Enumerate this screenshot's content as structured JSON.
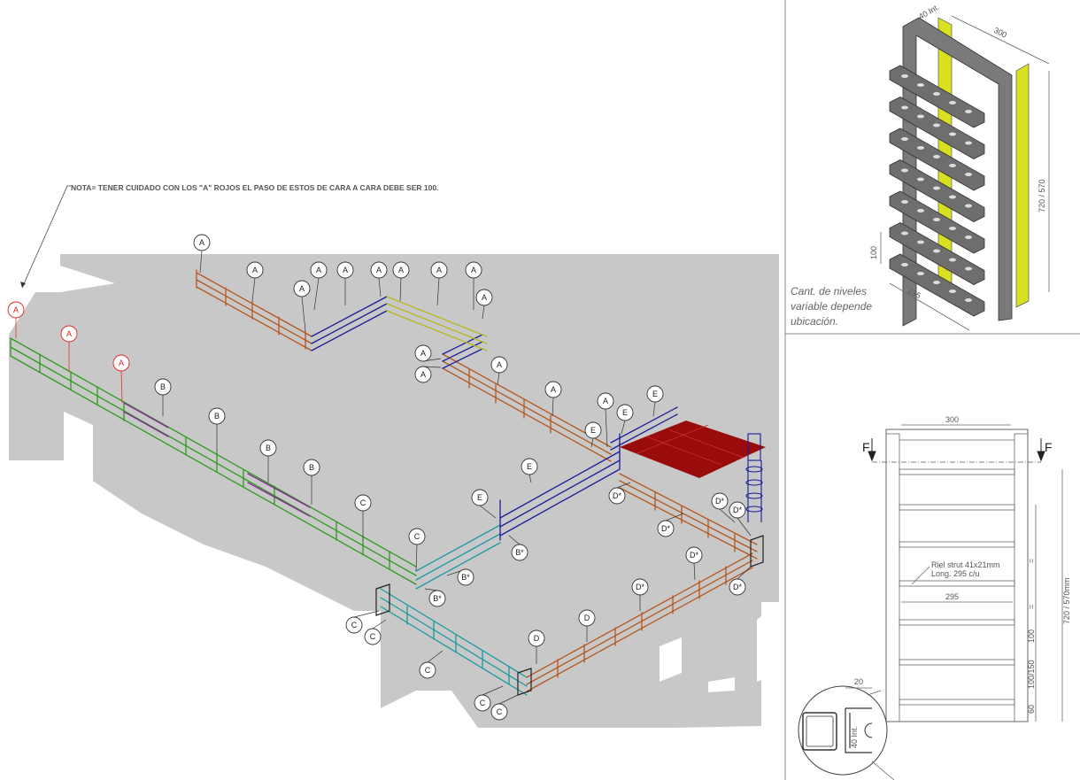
{
  "note": "NOTA= TENER CUIDADO CON LOS \"A\" ROJOS EL PASO DE ESTOS DE CARA A CARA DEBE SER 100.",
  "balloons": {
    "a": "A",
    "b": "B",
    "b_star": "B*",
    "c": "C",
    "d": "D",
    "d_star": "D*",
    "e": "E"
  },
  "iso_detail": {
    "dim_top": "300",
    "dim_inner": "40 Int.",
    "dim_height": "720 / 570",
    "dim_step": "100",
    "dim_depth": "295",
    "caption_lines": [
      "Cant. de niveles",
      "variable depende",
      "ubicación."
    ]
  },
  "front_detail": {
    "dim_top": "300",
    "section_left": "F",
    "section_right": "F",
    "rail_note_lines": [
      "Riel strut 41x21mm",
      "Long. 295 c/u"
    ],
    "dim_295": "295",
    "dim_height": "720 / 570mm",
    "dim_100": "100",
    "dim_100_150": "100/150",
    "dim_60": "60",
    "dim_eq": "=",
    "dim_20": "20",
    "dim_40_int": "40 Int."
  },
  "colors": {
    "ground": "#c8c8c8",
    "tray_brown": "#b5561e",
    "tray_blue": "#1c1c9a",
    "tray_yellow": "#b8b81e",
    "tray_green": "#2e9a1e",
    "tray_purple": "#8a2a9a",
    "tray_cyan": "#1a9aa0",
    "platform_red": "#9a0c0c",
    "warning_red": "#e02020"
  }
}
